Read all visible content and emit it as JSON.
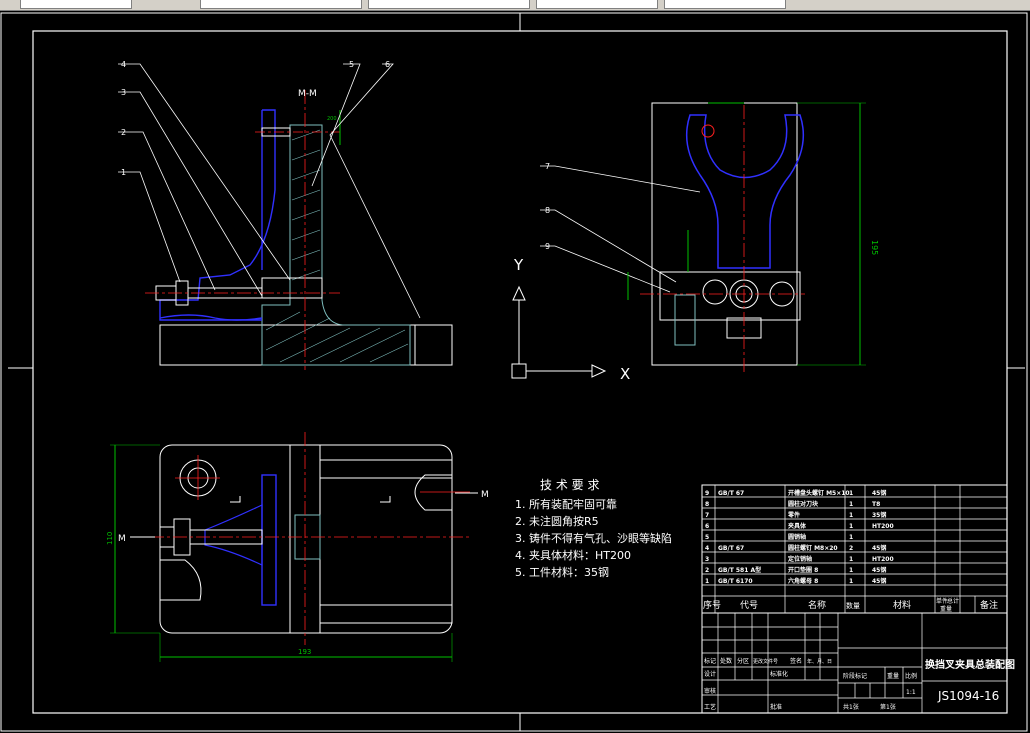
{
  "toolbar": {
    "colors": {
      "bg": "#d4d0c8",
      "field": "#ffffff"
    }
  },
  "drawing": {
    "colors": {
      "background": "#000000",
      "frame": "#ffffff",
      "part": "#3030ff",
      "section": "#7fbfbf",
      "center": "#ff2020",
      "dimension": "#00c000",
      "leader": "#ffffff"
    },
    "section_label": "M-M",
    "part_callouts": [
      "1",
      "2",
      "3",
      "4",
      "5",
      "6",
      "7",
      "8",
      "9"
    ],
    "cut_marker": "M",
    "axis_labels": {
      "x": "X",
      "y": "Y"
    },
    "dimensions": {
      "height_right": "195",
      "width_bottom": "193",
      "height_left": "110"
    },
    "tech_requirements": {
      "title": "技 术 要 求",
      "items": [
        "1. 所有装配牢固可靠",
        "2. 未注圆角按R5",
        "3. 铸件不得有气孔、沙眼等缺陷",
        "4. 夹具体材料：HT200",
        "5. 工件材料：35钢"
      ]
    },
    "bom": {
      "headers": {
        "no": "序号",
        "code": "代号",
        "name": "名称",
        "qty": "数量",
        "material": "材料",
        "unit_weight": "单件",
        "total_weight": "总计",
        "weight": "重量",
        "remark": "备注"
      },
      "rows": [
        {
          "no": "9",
          "code": "GB/T 67",
          "name": "开槽盘头螺钉 M5×10",
          "qty": "1",
          "material": "45钢"
        },
        {
          "no": "8",
          "code": "",
          "name": "圆柱对刀块",
          "qty": "1",
          "material": "T8"
        },
        {
          "no": "7",
          "code": "",
          "name": "零件",
          "qty": "1",
          "material": "35钢"
        },
        {
          "no": "6",
          "code": "",
          "name": "夹具体",
          "qty": "1",
          "material": "HT200"
        },
        {
          "no": "5",
          "code": "",
          "name": "圆销轴",
          "qty": "1",
          "material": ""
        },
        {
          "no": "4",
          "code": "GB/T 67",
          "name": "圆柱螺钉 M8×20",
          "qty": "2",
          "material": "45钢"
        },
        {
          "no": "3",
          "code": "",
          "name": "定位销轴",
          "qty": "1",
          "material": "HT200"
        },
        {
          "no": "2",
          "code": "GB/T 581 A型",
          "name": "开口垫圈 8",
          "qty": "1",
          "material": "45钢"
        },
        {
          "no": "1",
          "code": "GB/T 6170",
          "name": "六角螺母 8",
          "qty": "1",
          "material": "45钢"
        }
      ]
    },
    "title_block": {
      "title": "换挡叉夹具总装配图",
      "drawing_no": "JS1094-16",
      "scale": "1:1",
      "labels": {
        "mark": "标记",
        "count": "处数",
        "zone": "分区",
        "change_doc": "更改文件号",
        "sign": "签名",
        "date": "年、月、日",
        "design": "设计",
        "standardize": "标准化",
        "stage_mark": "阶段标记",
        "weight": "重量",
        "ratio": "比例",
        "review": "审核",
        "process": "工艺",
        "approve": "批准",
        "sheet_total": "共1张",
        "sheet_no": "第1张"
      }
    }
  }
}
